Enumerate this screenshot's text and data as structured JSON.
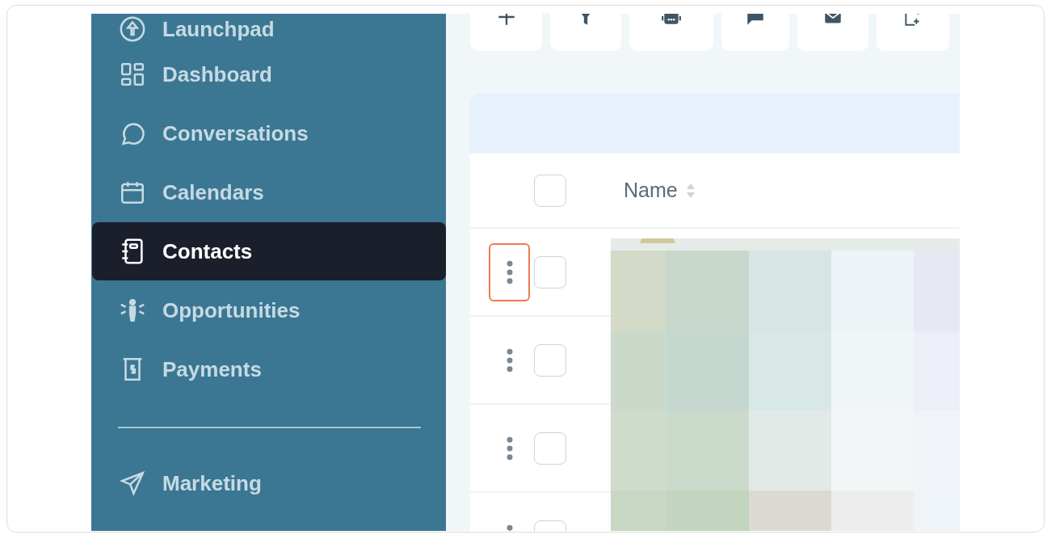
{
  "sidebar": {
    "sections": [
      [
        {
          "label": "Launchpad",
          "selected": false
        },
        {
          "label": "Dashboard",
          "selected": false
        },
        {
          "label": "Conversations",
          "selected": false
        },
        {
          "label": "Calendars",
          "selected": false
        },
        {
          "label": "Contacts",
          "selected": true
        },
        {
          "label": "Opportunities",
          "selected": false
        },
        {
          "label": "Payments",
          "selected": false
        }
      ],
      [
        {
          "label": "Marketing",
          "selected": false
        }
      ]
    ]
  },
  "table": {
    "header": {
      "checked": false,
      "column": "Name"
    },
    "rows": [
      {
        "checked": false,
        "highlighted": true
      },
      {
        "checked": false,
        "highlighted": false
      },
      {
        "checked": false,
        "highlighted": false
      },
      {
        "checked": false,
        "highlighted": false
      }
    ]
  }
}
